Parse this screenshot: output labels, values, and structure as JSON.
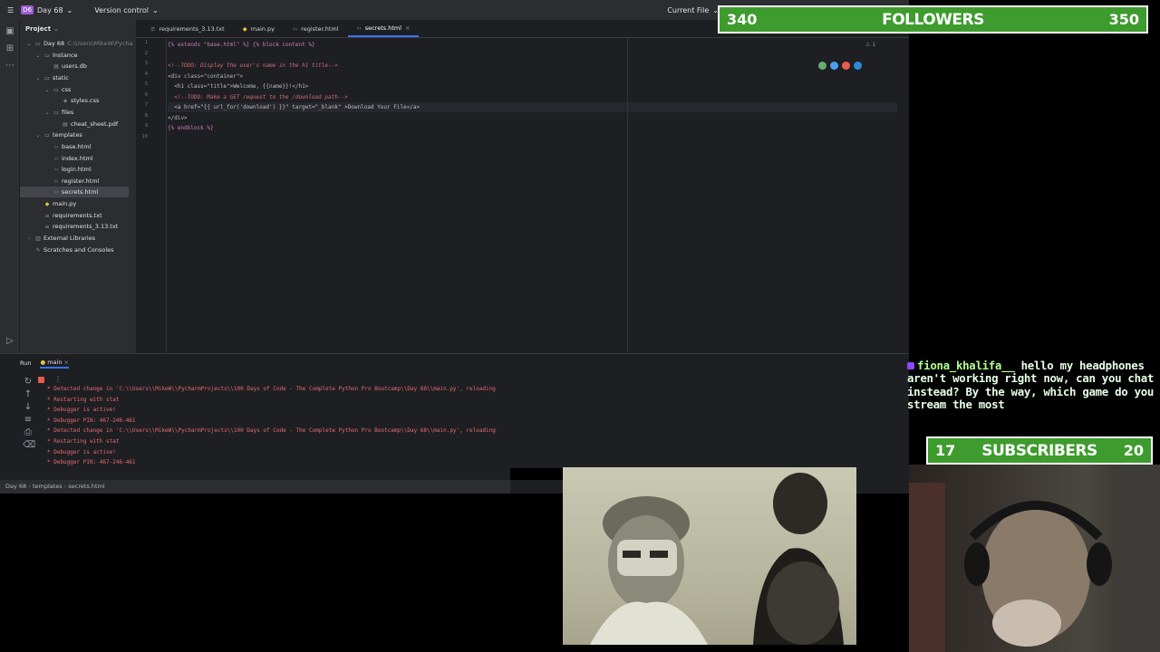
{
  "titlebar": {
    "project_badge": "D6",
    "project_name": "Day 68",
    "vcs_label": "Version control",
    "run_config": "Current File"
  },
  "project_panel": {
    "title": "Project",
    "tree": [
      {
        "label": "Day 68",
        "suffix": "C:\\Users\\MikeW\\Pycha",
        "depth": 0,
        "icon": "folder-icon",
        "expanded": true
      },
      {
        "label": "instance",
        "depth": 1,
        "icon": "folder-icon",
        "expanded": true
      },
      {
        "label": "users.db",
        "depth": 2,
        "icon": "database-icon"
      },
      {
        "label": "static",
        "depth": 1,
        "icon": "folder-icon",
        "expanded": true
      },
      {
        "label": "css",
        "depth": 2,
        "icon": "folder-icon",
        "expanded": true
      },
      {
        "label": "styles.css",
        "depth": 3,
        "icon": "css-file-icon"
      },
      {
        "label": "files",
        "depth": 2,
        "icon": "folder-icon",
        "expanded": true
      },
      {
        "label": "cheat_sheet.pdf",
        "depth": 3,
        "icon": "pdf-file-icon"
      },
      {
        "label": "templates",
        "depth": 1,
        "icon": "folder-icon",
        "expanded": true
      },
      {
        "label": "base.html",
        "depth": 2,
        "icon": "html-file-icon"
      },
      {
        "label": "index.html",
        "depth": 2,
        "icon": "html-file-icon"
      },
      {
        "label": "login.html",
        "depth": 2,
        "icon": "html-file-icon"
      },
      {
        "label": "register.html",
        "depth": 2,
        "icon": "html-file-icon"
      },
      {
        "label": "secrets.html",
        "depth": 2,
        "icon": "html-file-icon",
        "selected": true
      },
      {
        "label": "main.py",
        "depth": 1,
        "icon": "python-file-icon"
      },
      {
        "label": "requirements.txt",
        "depth": 1,
        "icon": "text-file-icon"
      },
      {
        "label": "requirements_3.13.txt",
        "depth": 1,
        "icon": "text-file-icon"
      },
      {
        "label": "External Libraries",
        "depth": 0,
        "icon": "library-icon"
      },
      {
        "label": "Scratches and Consoles",
        "depth": 0,
        "icon": "scratches-icon"
      }
    ]
  },
  "tabs": [
    {
      "label": "requirements_3.13.txt",
      "icon": "text-file-icon",
      "active": false
    },
    {
      "label": "main.py",
      "icon": "python-file-icon",
      "active": false
    },
    {
      "label": "register.html",
      "icon": "html-file-icon",
      "active": false
    },
    {
      "label": "secrets.html",
      "icon": "html-file-icon",
      "active": true
    }
  ],
  "editor": {
    "line_numbers": [
      "1",
      "2",
      "3",
      "4",
      "5",
      "6",
      "7",
      "8",
      "9",
      "10"
    ],
    "lines": [
      "{% extends \"base.html\" %} {% block content %}",
      "",
      "<!--TODO: Display the user's name in the h1 title-->",
      "<div class=\"container\">",
      "  <h1 class=\"title\">Welcome, {{name}}!</h1>",
      "  <!--TODO: Make a GET request to the /download path-->",
      "  <a href=\"{{ url_for('download') }}\" target=\"_blank\" >Download Your File</a>",
      "</div>",
      "{% endblock %}",
      ""
    ],
    "inspection_count": "1"
  },
  "run_panel": {
    "label": "Run",
    "config_tab": "main",
    "output": [
      " * Detected change in 'C:\\\\Users\\\\MikeW\\\\PycharmProjects\\\\100 Days of Code - The Complete Python Pro Bootcamp\\\\Day 68\\\\main.py', reloading",
      " * Restarting with stat",
      " * Debugger is active!",
      " * Debugger PIN: 467-246-461",
      " * Detected change in 'C:\\\\Users\\\\MikeW\\\\PycharmProjects\\\\100 Days of Code - The Complete Python Pro Bootcamp\\\\Day 68\\\\main.py', reloading",
      " * Restarting with stat",
      " * Debugger is active!",
      " * Debugger PIN: 467-246-461"
    ]
  },
  "statusbar": {
    "breadcrumb": [
      "Day 68",
      "templates",
      "secrets.html"
    ]
  },
  "overlay": {
    "followers": {
      "current": "340",
      "label": "FOLLOWERS",
      "goal": "350"
    },
    "subscribers": {
      "current": "17",
      "label": "SUBSCRIBERS",
      "goal": "20"
    },
    "chat": {
      "user": "fiona_khalifa__",
      "message": "hello my headphones aren't working right now, can you chat instead? By the way, which game do you stream the most"
    }
  },
  "colors": {
    "accent": "#3574f0",
    "goal_bar": "#3e9b2e",
    "console_text": "#e56a71",
    "comment": "#d06b7a",
    "string": "#6aab73"
  }
}
